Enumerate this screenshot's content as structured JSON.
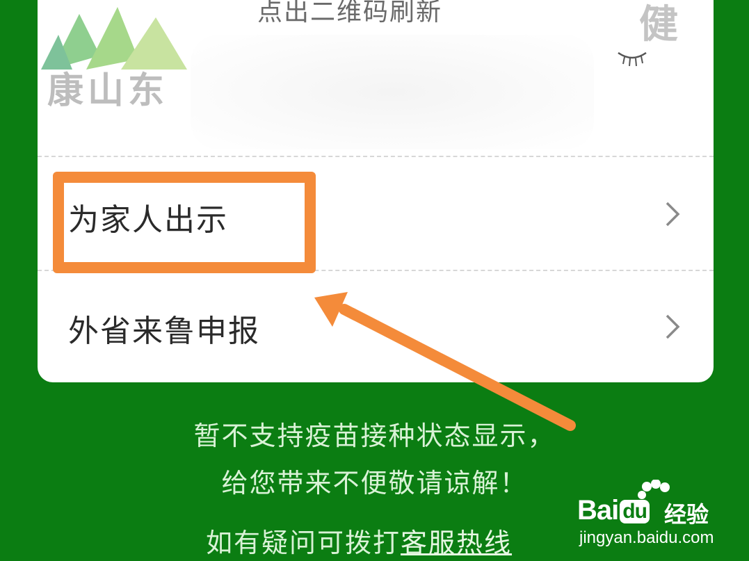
{
  "card": {
    "refresh_hint": "点出二维码刷新",
    "logo_left_text": "康山东",
    "logo_right_text": "健",
    "menu": [
      {
        "label": "为家人出示",
        "icon": "chevron-right-icon"
      },
      {
        "label": "外省来鲁申报",
        "icon": "chevron-right-icon"
      }
    ]
  },
  "annotation": {
    "highlight_color": "#f48b3a",
    "arrow_color": "#f48b3a"
  },
  "notice": {
    "line1": "暂不支持疫苗接种状态显示，",
    "line2": "给您带来不便敬请谅解！",
    "hotline_prefix": "如有疑问可拨打",
    "hotline_link": "客服热线"
  },
  "watermark": {
    "brand": "Bai",
    "brand_suffix": "经验",
    "url": "jingyan.baidu.com"
  },
  "colors": {
    "background": "#0b7d12",
    "card": "#ffffff",
    "notice_text": "#d9f2d6"
  }
}
